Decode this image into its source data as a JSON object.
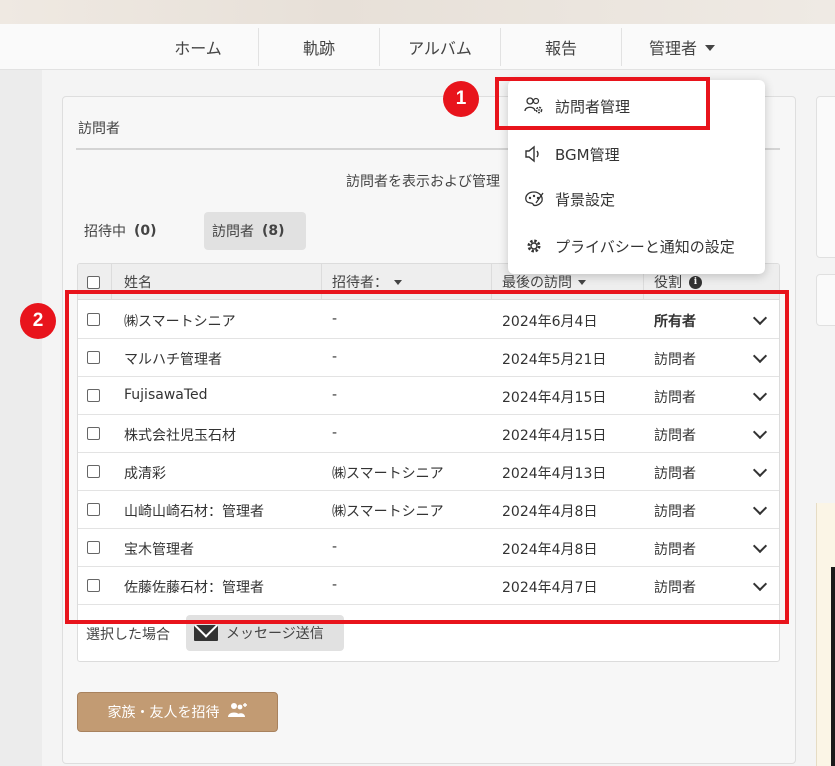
{
  "nav": {
    "home": "ホーム",
    "track": "軌跡",
    "album": "アルバム",
    "report": "報告",
    "admin": "管理者"
  },
  "dropdown": {
    "items": [
      {
        "label": "訪問者管理",
        "icon": "users-gear-icon"
      },
      {
        "label": "BGM管理",
        "icon": "speaker-icon"
      },
      {
        "label": "背景設定",
        "icon": "palette-icon"
      },
      {
        "label": "プライバシーと通知の設定",
        "icon": "gear-icon"
      }
    ]
  },
  "panel": {
    "title": "訪問者",
    "description": "訪問者を表示および管理"
  },
  "tabs": [
    {
      "label": "招待中",
      "count": "(0)"
    },
    {
      "label": "訪問者",
      "count": "(8)"
    }
  ],
  "table": {
    "headers": {
      "name": "姓名",
      "inviter": "招待者：",
      "last_visit": "最後の訪問",
      "role": "役割"
    },
    "rows": [
      {
        "name": "㈱スマートシニア",
        "inviter": "-",
        "last_visit": "2024年6月4日",
        "role": "所有者"
      },
      {
        "name": "マルハチ管理者",
        "inviter": "-",
        "last_visit": "2024年5月21日",
        "role": "訪問者"
      },
      {
        "name": "FujisawaTed",
        "inviter": "-",
        "last_visit": "2024年4月15日",
        "role": "訪問者"
      },
      {
        "name": "株式会社児玉石材",
        "inviter": "-",
        "last_visit": "2024年4月15日",
        "role": "訪問者"
      },
      {
        "name": "成清彩",
        "inviter": "㈱スマートシニア",
        "last_visit": "2024年4月13日",
        "role": "訪問者"
      },
      {
        "name": "山崎山崎石材：管理者",
        "inviter": "㈱スマートシニア",
        "last_visit": "2024年4月8日",
        "role": "訪問者"
      },
      {
        "name": "宝木管理者",
        "inviter": "-",
        "last_visit": "2024年4月8日",
        "role": "訪問者"
      },
      {
        "name": "佐藤佐藤石材：管理者",
        "inviter": "-",
        "last_visit": "2024年4月7日",
        "role": "訪問者"
      }
    ]
  },
  "footer": {
    "selected_label": "選択した場合",
    "message_button": "メッセージ送信"
  },
  "invite_button": "家族・友人を招待",
  "annotations": {
    "badge1": "1",
    "badge2": "2"
  },
  "colors": {
    "accent": "#c29b73",
    "highlight": "#e8141c"
  }
}
